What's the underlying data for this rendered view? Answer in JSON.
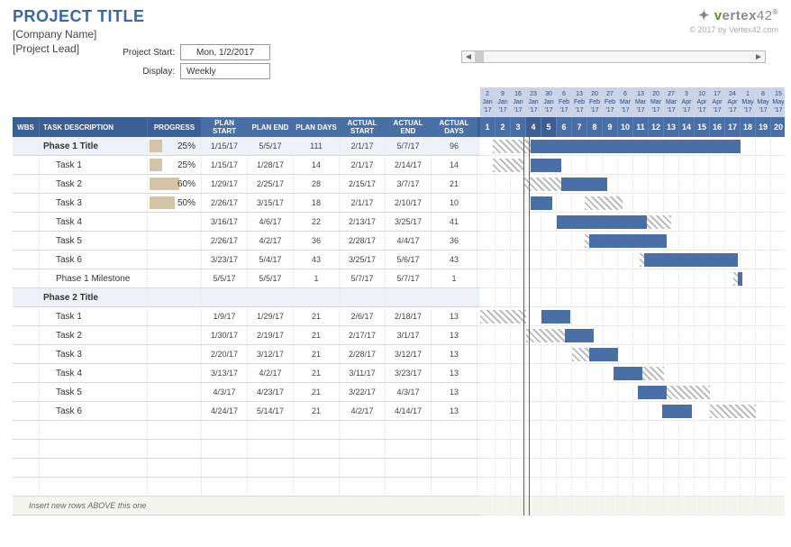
{
  "header": {
    "project_title": "PROJECT TITLE",
    "company_name": "[Company Name]",
    "project_lead": "[Project Lead]",
    "project_start_label": "Project Start:",
    "project_start_value": "Mon, 1/2/2017",
    "display_label": "Display:",
    "display_value": "Weekly"
  },
  "brand": {
    "logo_text": "vertex42",
    "copyright": "© 2017 by Vertex42.com"
  },
  "columns": {
    "wbs": "WBS",
    "task": "TASK DESCRIPTION",
    "progress": "PROGRESS",
    "plan_start": "PLAN START",
    "plan_end": "PLAN END",
    "plan_days": "PLAN DAYS",
    "actual_start": "ACTUAL START",
    "actual_end": "ACTUAL END",
    "actual_days": "ACTUAL DAYS"
  },
  "timeline": {
    "dates": [
      {
        "d": "2",
        "m": "Jan",
        "y": "'17"
      },
      {
        "d": "9",
        "m": "Jan",
        "y": "'17"
      },
      {
        "d": "16",
        "m": "Jan",
        "y": "'17"
      },
      {
        "d": "23",
        "m": "Jan",
        "y": "'17"
      },
      {
        "d": "30",
        "m": "Jan",
        "y": "'17"
      },
      {
        "d": "6",
        "m": "Feb",
        "y": "'17"
      },
      {
        "d": "13",
        "m": "Feb",
        "y": "'17"
      },
      {
        "d": "20",
        "m": "Feb",
        "y": "'17"
      },
      {
        "d": "27",
        "m": "Feb",
        "y": "'17"
      },
      {
        "d": "6",
        "m": "Mar",
        "y": "'17"
      },
      {
        "d": "13",
        "m": "Mar",
        "y": "'17"
      },
      {
        "d": "20",
        "m": "Mar",
        "y": "'17"
      },
      {
        "d": "27",
        "m": "Mar",
        "y": "'17"
      },
      {
        "d": "3",
        "m": "Apr",
        "y": "'17"
      },
      {
        "d": "10",
        "m": "Apr",
        "y": "'17"
      },
      {
        "d": "17",
        "m": "Apr",
        "y": "'17"
      },
      {
        "d": "24",
        "m": "Apr",
        "y": "'17"
      },
      {
        "d": "1",
        "m": "May",
        "y": "'17"
      },
      {
        "d": "8",
        "m": "May",
        "y": "'17"
      },
      {
        "d": "15",
        "m": "May",
        "y": "'17"
      }
    ],
    "week_numbers": [
      "1",
      "2",
      "3",
      "4",
      "5",
      "6",
      "7",
      "8",
      "9",
      "10",
      "11",
      "12",
      "13",
      "14",
      "15",
      "16",
      "17",
      "18",
      "19",
      "20"
    ],
    "today_week": 3.8
  },
  "rows": [
    {
      "type": "phase",
      "task": "Phase 1 Title",
      "progress": "25%",
      "progress_pct": 25,
      "plan_start": "1/15/17",
      "plan_end": "5/5/17",
      "plan_days": "111",
      "actual_start": "2/1/17",
      "actual_end": "5/7/17",
      "actual_days": "96",
      "gantt": {
        "plan_start": 1.8,
        "plan_w": 16,
        "actual_start": 4.3,
        "actual_w": 13.7
      }
    },
    {
      "type": "task",
      "task": "Task 1",
      "progress": "25%",
      "progress_pct": 25,
      "plan_start": "1/15/17",
      "plan_end": "1/28/17",
      "plan_days": "14",
      "actual_start": "2/1/17",
      "actual_end": "2/14/17",
      "actual_days": "14",
      "gantt": {
        "plan_start": 1.8,
        "plan_w": 2,
        "actual_start": 4.3,
        "actual_w": 2
      }
    },
    {
      "type": "task",
      "task": "Task 2",
      "progress": "60%",
      "progress_pct": 60,
      "plan_start": "1/29/17",
      "plan_end": "2/25/17",
      "plan_days": "28",
      "actual_start": "2/15/17",
      "actual_end": "3/7/17",
      "actual_days": "21",
      "gantt": {
        "plan_start": 3.8,
        "plan_w": 4,
        "actual_start": 6.3,
        "actual_w": 3
      }
    },
    {
      "type": "task",
      "task": "Task 3",
      "progress": "50%",
      "progress_pct": 50,
      "plan_start": "2/26/17",
      "plan_end": "3/15/17",
      "plan_days": "18",
      "actual_start": "2/1/17",
      "actual_end": "2/10/17",
      "actual_days": "10",
      "gantt": {
        "plan_start": 7.8,
        "plan_w": 2.5,
        "actual_start": 4.3,
        "actual_w": 1.4
      }
    },
    {
      "type": "task",
      "task": "Task 4",
      "progress": "",
      "progress_pct": 0,
      "plan_start": "3/16/17",
      "plan_end": "4/6/17",
      "plan_days": "22",
      "actual_start": "2/13/17",
      "actual_end": "3/25/17",
      "actual_days": "41",
      "gantt": {
        "plan_start": 10.4,
        "plan_w": 3.1,
        "actual_start": 6,
        "actual_w": 5.9
      }
    },
    {
      "type": "task",
      "task": "Task 5",
      "progress": "",
      "progress_pct": 0,
      "plan_start": "2/26/17",
      "plan_end": "4/2/17",
      "plan_days": "36",
      "actual_start": "2/28/17",
      "actual_end": "4/4/17",
      "actual_days": "36",
      "gantt": {
        "plan_start": 7.8,
        "plan_w": 5.1,
        "actual_start": 8.1,
        "actual_w": 5.1
      }
    },
    {
      "type": "task",
      "task": "Task 6",
      "progress": "",
      "progress_pct": 0,
      "plan_start": "3/23/17",
      "plan_end": "5/4/17",
      "plan_days": "43",
      "actual_start": "3/25/17",
      "actual_end": "5/6/17",
      "actual_days": "43",
      "gantt": {
        "plan_start": 11.4,
        "plan_w": 6.1,
        "actual_start": 11.7,
        "actual_w": 6.1
      }
    },
    {
      "type": "task",
      "task": "Phase 1 Milestone",
      "progress": "",
      "progress_pct": 0,
      "plan_start": "5/5/17",
      "plan_end": "5/5/17",
      "plan_days": "1",
      "actual_start": "5/7/17",
      "actual_end": "5/7/17",
      "actual_days": "1",
      "gantt": {
        "plan_start": 17.5,
        "plan_w": 0.3,
        "actual_start": 17.8,
        "actual_w": 0.3,
        "milestone": true
      }
    },
    {
      "type": "phase",
      "task": "Phase 2 Title",
      "progress": "",
      "progress_pct": 0,
      "plan_start": "",
      "plan_end": "",
      "plan_days": "",
      "actual_start": "",
      "actual_end": "",
      "actual_days": "",
      "gantt": null
    },
    {
      "type": "task",
      "task": "Task 1",
      "progress": "",
      "progress_pct": 0,
      "plan_start": "1/9/17",
      "plan_end": "1/29/17",
      "plan_days": "21",
      "actual_start": "2/6/17",
      "actual_end": "2/18/17",
      "actual_days": "13",
      "gantt": {
        "plan_start": 1,
        "plan_w": 3,
        "actual_start": 5,
        "actual_w": 1.9
      }
    },
    {
      "type": "task",
      "task": "Task 2",
      "progress": "",
      "progress_pct": 0,
      "plan_start": "1/30/17",
      "plan_end": "2/19/17",
      "plan_days": "21",
      "actual_start": "2/17/17",
      "actual_end": "3/1/17",
      "actual_days": "13",
      "gantt": {
        "plan_start": 4,
        "plan_w": 3,
        "actual_start": 6.5,
        "actual_w": 1.9
      }
    },
    {
      "type": "task",
      "task": "Task 3",
      "progress": "",
      "progress_pct": 0,
      "plan_start": "2/20/17",
      "plan_end": "3/12/17",
      "plan_days": "21",
      "actual_start": "2/28/17",
      "actual_end": "3/12/17",
      "actual_days": "13",
      "gantt": {
        "plan_start": 7,
        "plan_w": 3,
        "actual_start": 8.1,
        "actual_w": 1.9
      }
    },
    {
      "type": "task",
      "task": "Task 4",
      "progress": "",
      "progress_pct": 0,
      "plan_start": "3/13/17",
      "plan_end": "4/2/17",
      "plan_days": "21",
      "actual_start": "3/11/17",
      "actual_end": "3/23/17",
      "actual_days": "13",
      "gantt": {
        "plan_start": 10,
        "plan_w": 3,
        "actual_start": 9.7,
        "actual_w": 1.9
      }
    },
    {
      "type": "task",
      "task": "Task 5",
      "progress": "",
      "progress_pct": 0,
      "plan_start": "4/3/17",
      "plan_end": "4/23/17",
      "plan_days": "21",
      "actual_start": "3/22/17",
      "actual_end": "4/3/17",
      "actual_days": "13",
      "gantt": {
        "plan_start": 13,
        "plan_w": 3,
        "actual_start": 11.3,
        "actual_w": 1.9
      }
    },
    {
      "type": "task",
      "task": "Task 6",
      "progress": "",
      "progress_pct": 0,
      "plan_start": "4/24/17",
      "plan_end": "5/14/17",
      "plan_days": "21",
      "actual_start": "4/2/17",
      "actual_end": "4/14/17",
      "actual_days": "13",
      "gantt": {
        "plan_start": 16,
        "plan_w": 3,
        "actual_start": 12.9,
        "actual_w": 1.9
      }
    }
  ],
  "footer_note": "Insert new rows ABOVE this one",
  "empty_row_count": 4
}
